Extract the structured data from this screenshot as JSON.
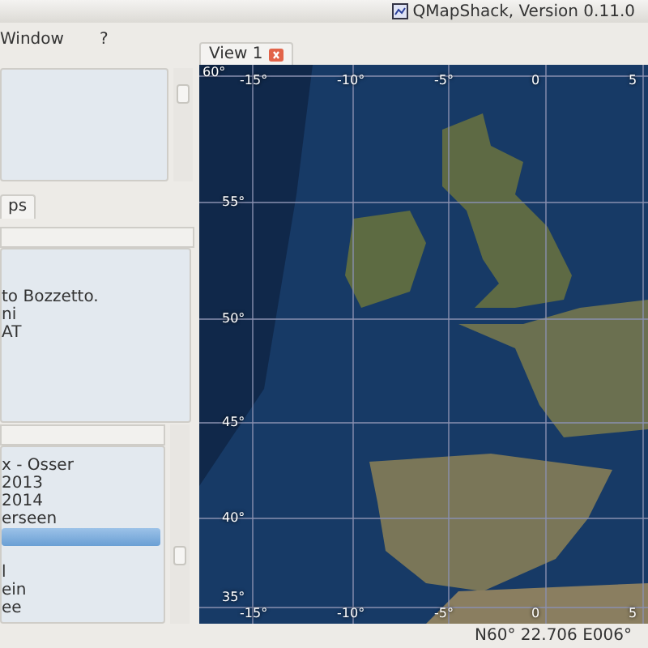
{
  "window": {
    "title": "QMapShack, Version 0.11.0"
  },
  "menu": [
    "Window",
    "?"
  ],
  "left_tabs": [
    {
      "label": "ps",
      "selected": true
    }
  ],
  "workspace_list": {
    "items": [
      {
        "label": "to Bozzetto."
      },
      {
        "label": "ni"
      },
      {
        "label": "AT"
      }
    ]
  },
  "project_list": {
    "items": [
      {
        "label": "x - Osser",
        "selected": false
      },
      {
        "label": "2013",
        "selected": false
      },
      {
        "label": "2014",
        "selected": false
      },
      {
        "label": "erseen",
        "selected": false
      },
      {
        "selected": true
      },
      {
        "label": "l",
        "selected": false
      },
      {
        "label": "ein",
        "selected": false
      },
      {
        "label": "ee",
        "selected": false
      }
    ]
  },
  "view_tabs": [
    {
      "label": "View 1",
      "selected": true
    }
  ],
  "map": {
    "top_labels": [
      "-15°",
      "-10°",
      "-5°",
      "0",
      "5"
    ],
    "bottom_labels": [
      "-15°",
      "-10°",
      "-5°",
      "0",
      "5"
    ],
    "left_labels": [
      "60°",
      "55°",
      "50°",
      "45°",
      "40°",
      "35°"
    ]
  },
  "status_bar": {
    "position": "N60° 22.706 E006°"
  }
}
